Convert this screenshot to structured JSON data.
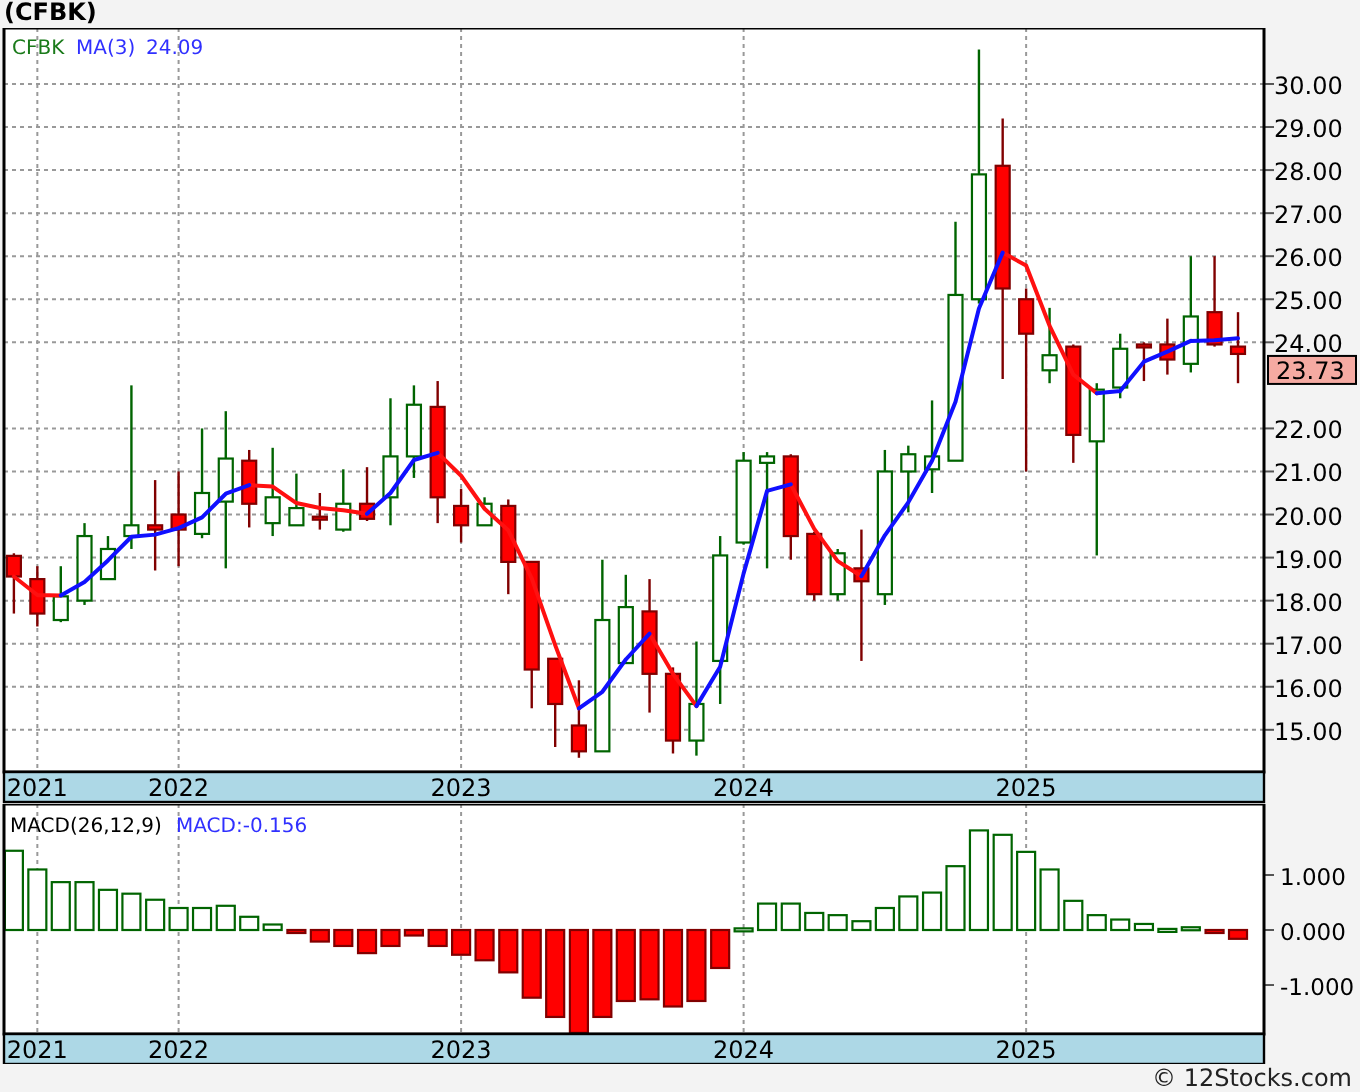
{
  "title": "(CFBK)",
  "price_chart": {
    "legend": {
      "symbol": "CFBK",
      "ma_label": "MA(3)",
      "ma_value": "24.09"
    },
    "last_price_label": "23.73",
    "chart_data": {
      "type": "candlestick",
      "x": [
        2021.417,
        2021.5,
        2021.583,
        2021.667,
        2021.75,
        2021.833,
        2021.917,
        2022.0,
        2022.083,
        2022.167,
        2022.25,
        2022.333,
        2022.417,
        2022.5,
        2022.583,
        2022.667,
        2022.75,
        2022.833,
        2022.917,
        2023.0,
        2023.083,
        2023.167,
        2023.25,
        2023.333,
        2023.417,
        2023.5,
        2023.583,
        2023.667,
        2023.75,
        2023.833,
        2023.917,
        2024.0,
        2024.083,
        2024.167,
        2024.25,
        2024.333,
        2024.417,
        2024.5,
        2024.583,
        2024.667,
        2024.75,
        2024.833,
        2024.917,
        2025.0,
        2025.083,
        2025.167,
        2025.25,
        2025.333,
        2025.417,
        2025.5,
        2025.583,
        2025.667,
        2025.75
      ],
      "ohlc": [
        [
          19.04,
          19.1,
          17.7,
          18.56
        ],
        [
          18.5,
          18.8,
          17.4,
          17.7
        ],
        [
          17.55,
          18.8,
          17.5,
          18.1
        ],
        [
          18.0,
          19.8,
          17.9,
          19.5
        ],
        [
          18.5,
          19.5,
          18.5,
          19.2
        ],
        [
          19.5,
          23.0,
          19.2,
          19.75
        ],
        [
          19.75,
          20.8,
          18.7,
          19.65
        ],
        [
          20.0,
          21.0,
          18.8,
          19.65
        ],
        [
          19.55,
          22.0,
          19.45,
          20.5
        ],
        [
          20.3,
          22.4,
          18.75,
          21.3
        ],
        [
          21.25,
          21.5,
          19.7,
          20.25
        ],
        [
          19.8,
          21.55,
          19.5,
          20.4
        ],
        [
          19.75,
          20.95,
          19.75,
          20.15
        ],
        [
          19.95,
          20.5,
          19.65,
          19.9
        ],
        [
          19.65,
          21.05,
          19.6,
          20.25
        ],
        [
          20.25,
          21.1,
          19.85,
          19.9
        ],
        [
          20.4,
          22.7,
          19.75,
          21.35
        ],
        [
          21.35,
          23.0,
          20.85,
          22.55
        ],
        [
          22.5,
          23.1,
          19.8,
          20.4
        ],
        [
          20.2,
          20.6,
          19.35,
          19.75
        ],
        [
          19.75,
          20.4,
          19.75,
          20.25
        ],
        [
          20.2,
          20.35,
          18.15,
          18.9
        ],
        [
          18.9,
          18.9,
          15.5,
          16.4
        ],
        [
          16.65,
          16.65,
          14.6,
          15.6
        ],
        [
          15.1,
          16.15,
          14.35,
          14.5
        ],
        [
          14.5,
          18.95,
          14.5,
          17.55
        ],
        [
          16.55,
          18.6,
          16.55,
          17.85
        ],
        [
          17.75,
          18.5,
          15.4,
          16.3
        ],
        [
          16.3,
          16.45,
          14.45,
          14.75
        ],
        [
          14.75,
          17.05,
          14.4,
          15.6
        ],
        [
          16.6,
          19.5,
          15.6,
          19.05
        ],
        [
          19.35,
          21.45,
          19.3,
          21.25
        ],
        [
          21.2,
          21.45,
          18.75,
          21.35
        ],
        [
          21.35,
          21.4,
          18.95,
          19.5
        ],
        [
          19.55,
          19.6,
          18.0,
          18.15
        ],
        [
          18.15,
          19.2,
          18.0,
          19.1
        ],
        [
          18.75,
          19.65,
          16.6,
          18.45
        ],
        [
          18.15,
          21.5,
          17.9,
          21.0
        ],
        [
          21.0,
          21.6,
          20.05,
          21.4
        ],
        [
          21.05,
          22.65,
          20.5,
          21.35
        ],
        [
          21.25,
          26.8,
          21.25,
          25.1
        ],
        [
          25.0,
          30.8,
          24.9,
          27.9
        ],
        [
          28.1,
          29.2,
          23.15,
          25.25
        ],
        [
          25.0,
          25.25,
          21.0,
          24.2
        ],
        [
          23.35,
          24.8,
          23.05,
          23.7
        ],
        [
          23.9,
          23.95,
          21.2,
          21.85
        ],
        [
          21.7,
          23.05,
          19.05,
          22.9
        ],
        [
          22.95,
          24.2,
          22.7,
          23.85
        ],
        [
          23.95,
          24.0,
          23.1,
          23.9
        ],
        [
          23.95,
          24.55,
          23.25,
          23.6
        ],
        [
          23.5,
          26.0,
          23.3,
          24.6
        ],
        [
          24.7,
          26.0,
          23.9,
          23.95
        ],
        [
          23.9,
          24.7,
          23.05,
          23.73
        ]
      ],
      "xlim": [
        2021.382,
        2025.842
      ],
      "ylim": [
        14.02,
        31.3
      ],
      "grid": true,
      "xticks": [
        {
          "value": 2021.5,
          "label": "2021"
        },
        {
          "value": 2022,
          "label": "2022"
        },
        {
          "value": 2023,
          "label": "2023"
        },
        {
          "value": 2024,
          "label": "2024"
        },
        {
          "value": 2025,
          "label": "2025"
        }
      ],
      "yticks": [
        {
          "value": 15,
          "label": "15.00"
        },
        {
          "value": 16,
          "label": "16.00"
        },
        {
          "value": 17,
          "label": "17.00"
        },
        {
          "value": 18,
          "label": "18.00"
        },
        {
          "value": 19,
          "label": "19.00"
        },
        {
          "value": 20,
          "label": "20.00"
        },
        {
          "value": 21,
          "label": "21.00"
        },
        {
          "value": 22,
          "label": "22.00"
        },
        {
          "value": 24,
          "label": "24.00"
        },
        {
          "value": 25,
          "label": "25.00"
        },
        {
          "value": 26,
          "label": "26.00"
        },
        {
          "value": 27,
          "label": "27.00"
        },
        {
          "value": 28,
          "label": "28.00"
        },
        {
          "value": 29,
          "label": "29.00"
        },
        {
          "value": 30,
          "label": "30.00"
        }
      ]
    }
  },
  "macd_chart": {
    "legend": {
      "name": "MACD(26,12,9)",
      "value": "MACD:-0.156"
    },
    "chart_data": {
      "type": "bar",
      "x": [
        2021.417,
        2021.5,
        2021.583,
        2021.667,
        2021.75,
        2021.833,
        2021.917,
        2022.0,
        2022.083,
        2022.167,
        2022.25,
        2022.333,
        2022.417,
        2022.5,
        2022.583,
        2022.667,
        2022.75,
        2022.833,
        2022.917,
        2023.0,
        2023.083,
        2023.167,
        2023.25,
        2023.333,
        2023.417,
        2023.5,
        2023.583,
        2023.667,
        2023.75,
        2023.833,
        2023.917,
        2024.0,
        2024.083,
        2024.167,
        2024.25,
        2024.333,
        2024.417,
        2024.5,
        2024.583,
        2024.667,
        2024.75,
        2024.833,
        2024.917,
        2025.0,
        2025.083,
        2025.167,
        2025.25,
        2025.333,
        2025.417,
        2025.5,
        2025.583,
        2025.667,
        2025.75
      ],
      "values": [
        1.44,
        1.1,
        0.87,
        0.87,
        0.73,
        0.66,
        0.55,
        0.4,
        0.4,
        0.44,
        0.24,
        0.1,
        -0.05,
        -0.21,
        -0.29,
        -0.42,
        -0.29,
        -0.1,
        -0.29,
        -0.45,
        -0.55,
        -0.77,
        -1.23,
        -1.58,
        -1.87,
        -1.58,
        -1.29,
        -1.26,
        -1.39,
        -1.29,
        -0.69,
        0.03,
        0.48,
        0.48,
        0.31,
        0.27,
        0.16,
        0.4,
        0.61,
        0.68,
        1.16,
        1.81,
        1.73,
        1.42,
        1.1,
        0.53,
        0.27,
        0.19,
        0.11,
        0.02,
        0.05,
        -0.05,
        -0.16
      ],
      "xlim": [
        2021.382,
        2025.842
      ],
      "ylim": [
        -1.89,
        2.29
      ],
      "grid": true,
      "xticks": [
        {
          "value": 2021.5,
          "label": "2021"
        },
        {
          "value": 2022,
          "label": "2022"
        },
        {
          "value": 2023,
          "label": "2023"
        },
        {
          "value": 2024,
          "label": "2024"
        },
        {
          "value": 2025,
          "label": "2025"
        }
      ],
      "yticks": [
        {
          "value": 1,
          "label": "1.000"
        },
        {
          "value": 0,
          "label": "0.000"
        },
        {
          "value": -1,
          "label": "-1.000"
        }
      ]
    }
  },
  "footer": "© 12Stocks.com"
}
